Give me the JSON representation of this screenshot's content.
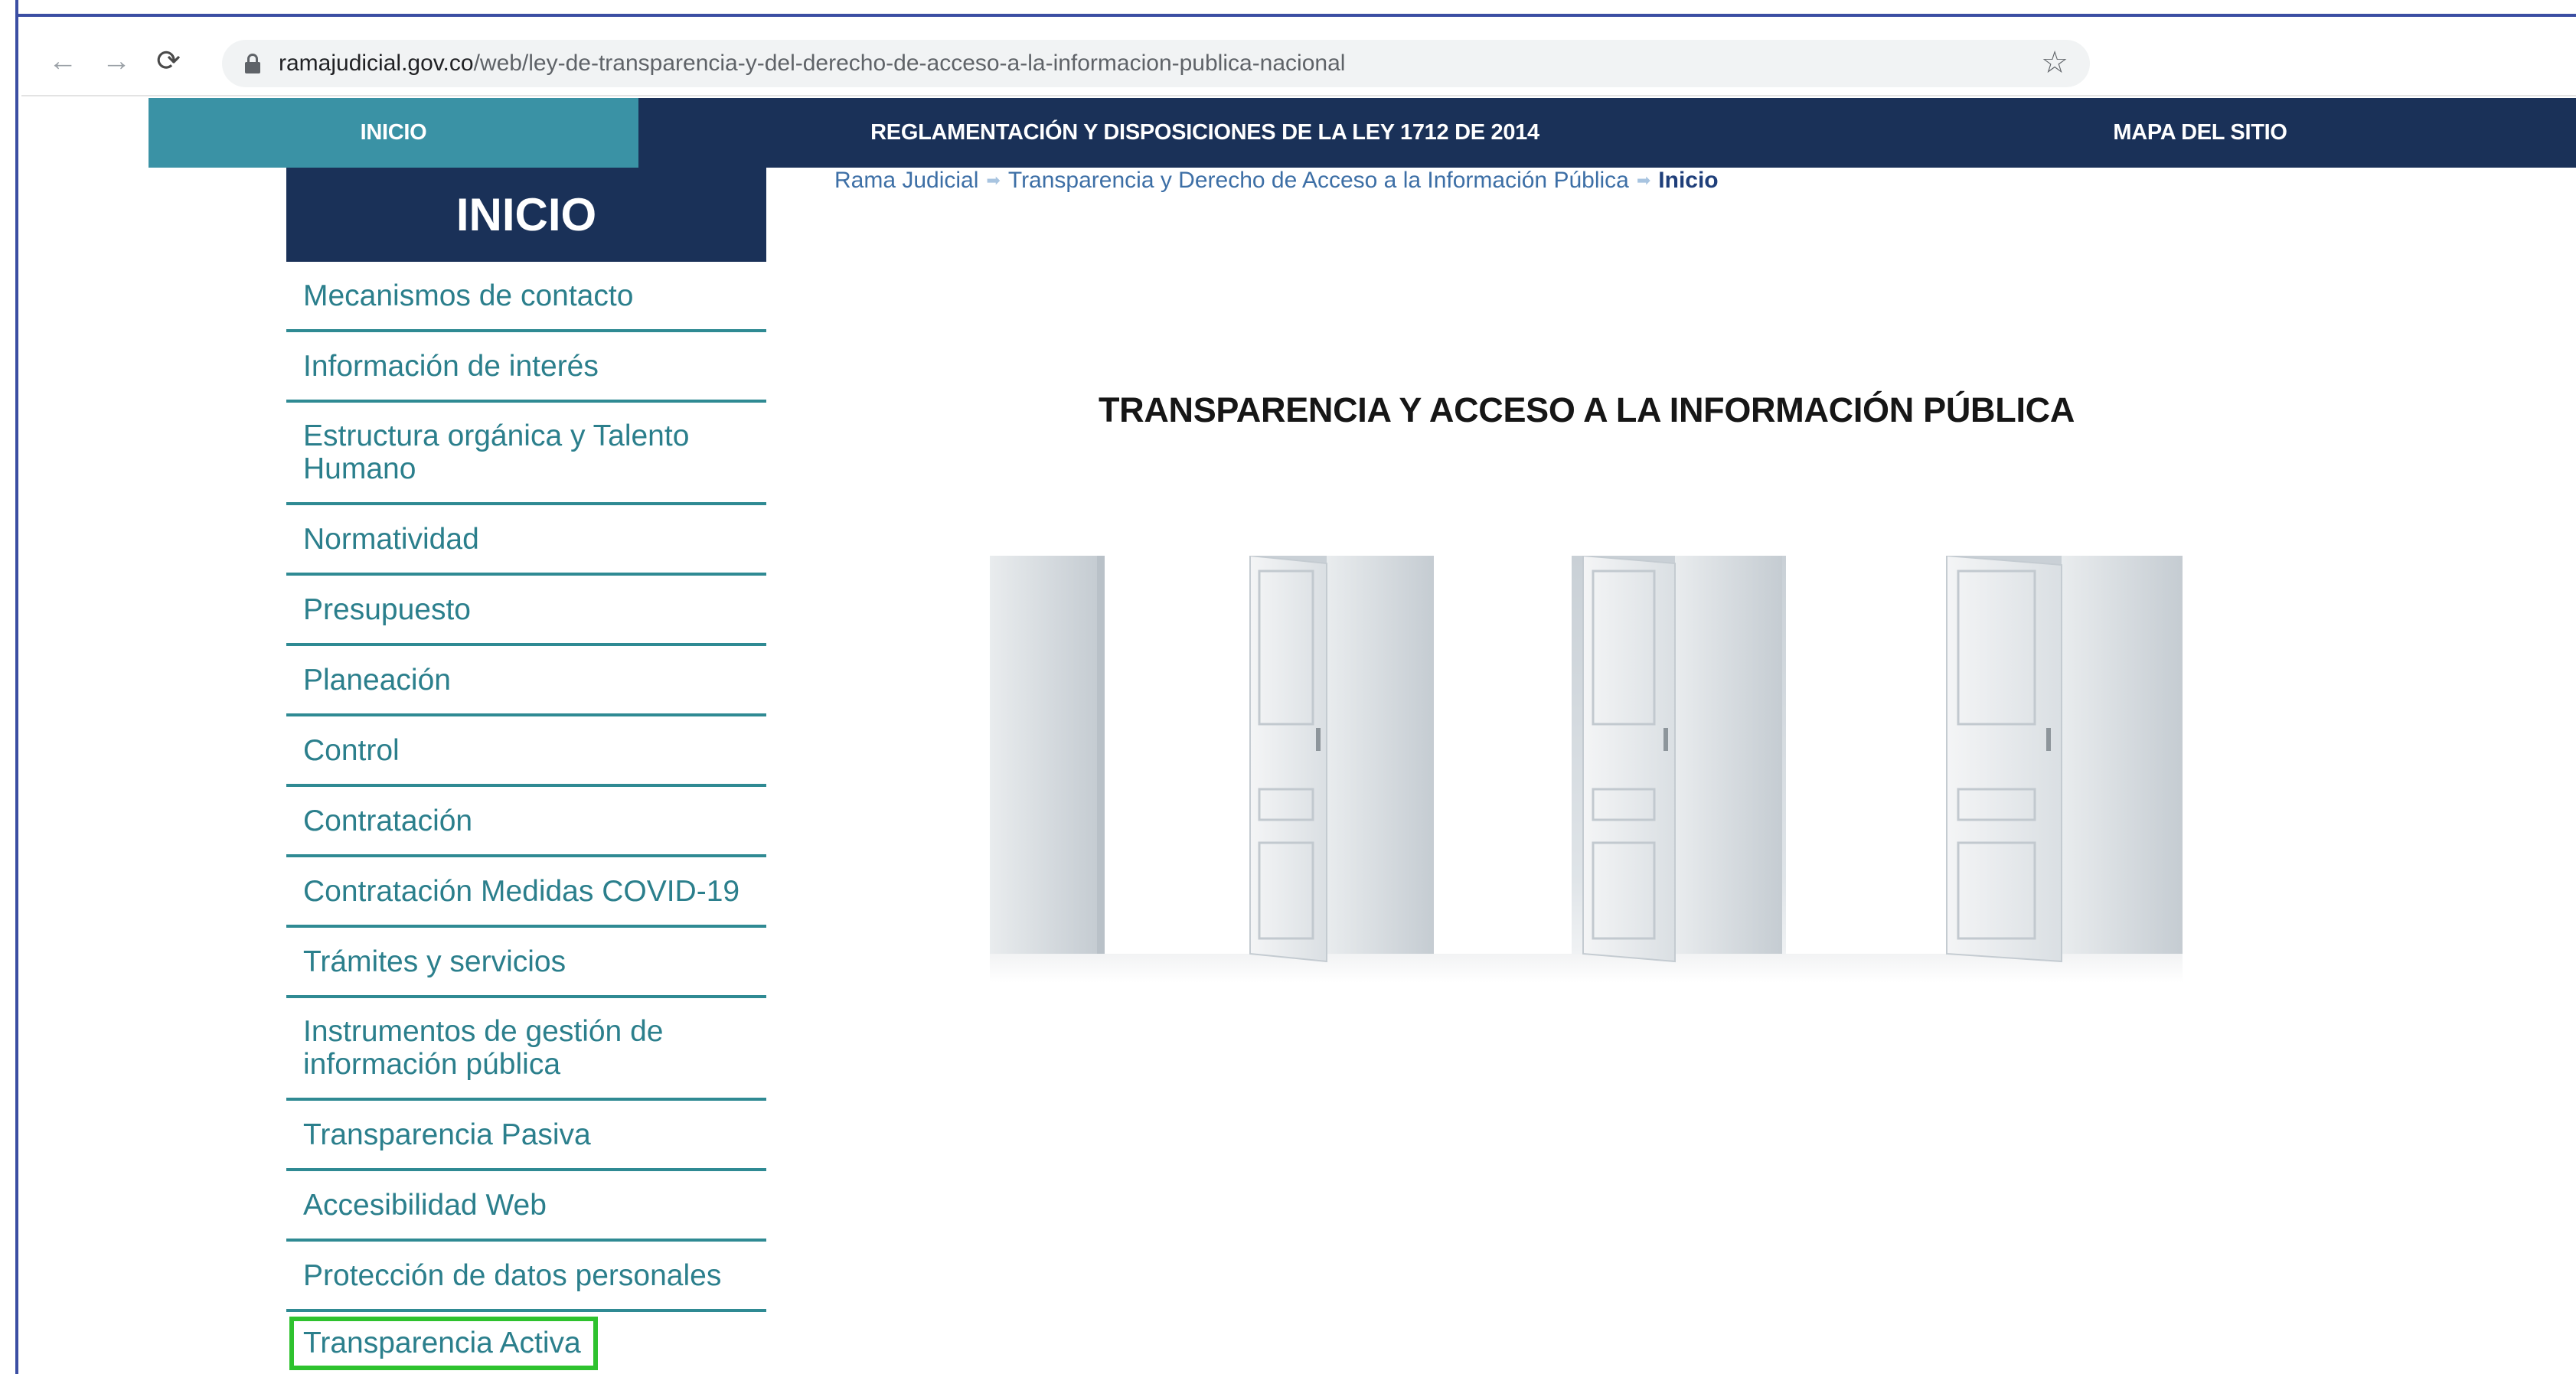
{
  "browser": {
    "url_host": "ramajudicial.gov.co",
    "url_path": "/web/ley-de-transparencia-y-del-derecho-de-acceso-a-la-informacion-publica-nacional"
  },
  "topnav": {
    "items": [
      "INICIO",
      "REGLAMENTACIÓN Y DISPOSICIONES DE LA LEY 1712 DE 2014",
      "MAPA DEL SITIO"
    ],
    "active_color": "#3a92a5",
    "bar_color": "#1a3158"
  },
  "sidebar": {
    "title": "INICIO",
    "items": [
      {
        "label": "Mecanismos de contacto"
      },
      {
        "label": "Información de interés"
      },
      {
        "label": "Estructura orgánica y Talento Humano"
      },
      {
        "label": "Normatividad"
      },
      {
        "label": "Presupuesto"
      },
      {
        "label": "Planeación"
      },
      {
        "label": "Control"
      },
      {
        "label": "Contratación"
      },
      {
        "label": "Contratación Medidas COVID-19"
      },
      {
        "label": "Trámites y servicios"
      },
      {
        "label": "Instrumentos de gestión de información pública"
      },
      {
        "label": "Transparencia Pasiva"
      },
      {
        "label": "Accesibilidad Web"
      },
      {
        "label": "Protección de datos personales"
      },
      {
        "label": "Transparencia Activa"
      }
    ],
    "highlight_color": "#2ec22e"
  },
  "breadcrumb": {
    "items": [
      "Rama Judicial",
      "Transparencia y Derecho de Acceso a la Información Pública"
    ],
    "current": "Inicio"
  },
  "main": {
    "title": "TRANSPARENCIA Y ACCESO A LA INFORMACIÓN PÚBLICA"
  }
}
